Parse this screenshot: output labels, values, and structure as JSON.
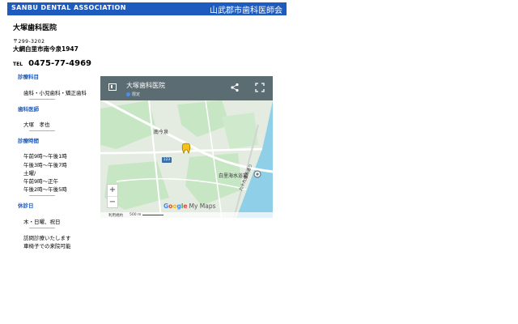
{
  "header": {
    "org_en": "SANBU DENTAL ASSOCIATION",
    "org_jp": "山武郡市歯科医師会",
    "bar_color": "#1e5bbf"
  },
  "clinic": {
    "name": "大塚歯科医院",
    "zip": "〒299-3202",
    "address": "大網白里市南今泉1947",
    "tel_label": "TEL",
    "tel_number": "0475-77-4969"
  },
  "sections": {
    "specialty": {
      "heading": "診療科目",
      "lines": [
        "歯科・小児歯科・矯正歯科"
      ],
      "divider": "-------------------"
    },
    "dentist": {
      "heading": "歯科医師",
      "lines": [
        "大塚　孝也"
      ],
      "divider": "-------------------"
    },
    "hours": {
      "heading": "診療時間",
      "lines": [
        "午前9時〜午後1時",
        "午後3時〜午後7時",
        "土曜/",
        "午前9時〜正午",
        "午後2時〜午後5時"
      ],
      "divider": "-------------------"
    },
    "closed": {
      "heading": "休診日",
      "lines": [
        "木・日曜、祝日"
      ],
      "divider": "-------------------",
      "notes": [
        "訪問診療いたします",
        "車椅子での来院可能"
      ]
    }
  },
  "map": {
    "title": "大塚歯科医院",
    "subtitle": "限定",
    "labels": {
      "area": "南今泉",
      "station": "白里海水浴場",
      "road": "123",
      "coast": "九十九里浜通り"
    },
    "zoom_in": "+",
    "zoom_out": "−",
    "brand_rest": "My Maps",
    "footer_terms": "利用規約",
    "footer_scale": "500 m",
    "icons": [
      "sidebar-icon",
      "share-icon",
      "fullscreen-icon",
      "tooth-marker-icon",
      "location-pin-icon"
    ],
    "colors": {
      "water": "#8fcfe8",
      "land": "#e4ece1",
      "park": "#c6e6c4",
      "road": "#ffffff"
    }
  }
}
